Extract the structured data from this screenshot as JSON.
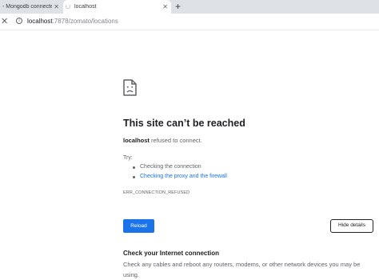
{
  "tabs": [
    {
      "title": "- Mongodb connected u",
      "active": false
    },
    {
      "title": "localhost",
      "active": true
    }
  ],
  "toolbar": {
    "url_host": "localhost",
    "url_path": ":7878/zomato/locations"
  },
  "error": {
    "icon": "sad-page-icon",
    "heading": "This site can’t be reached",
    "host": "localhost",
    "message": " refused to connect.",
    "try_label": "Try:",
    "suggestions": [
      {
        "text": "Checking the connection",
        "link": false
      },
      {
        "text": "Checking the proxy and the firewall",
        "link": true
      }
    ],
    "code": "ERR_CONNECTION_REFUSED"
  },
  "buttons": {
    "reload": "Reload",
    "hide_details": "Hide details"
  },
  "details": {
    "title": "Check your Internet connection",
    "body": "Check any cables and reboot any routers, modems, or other network devices you may be using."
  },
  "colors": {
    "accent": "#1a73e8",
    "tabstrip": "#dee1e6",
    "text": "#202124",
    "secondary_text": "#5f6368"
  }
}
